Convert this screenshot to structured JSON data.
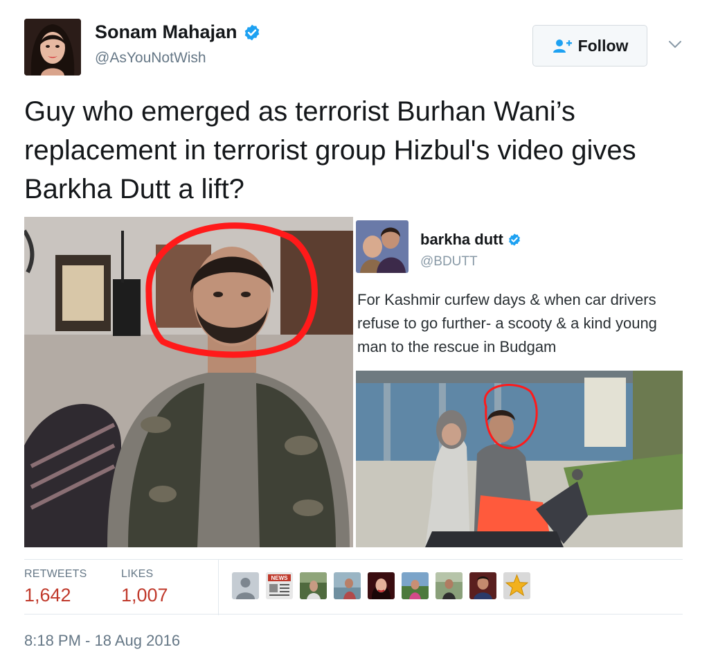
{
  "author": {
    "name": "Sonam Mahajan",
    "handle": "@AsYouNotWish",
    "verified": true
  },
  "follow_button": {
    "label": "Follow"
  },
  "tweet": {
    "text": "Guy who emerged as terrorist Burhan Wani’s replacement in terrorist group Hizbul's video gives Barkha Dutt a lift?"
  },
  "embedded_tweet": {
    "name": "barkha dutt",
    "handle": "@BDUTT",
    "text": "For Kashmir curfew days & when car drivers refuse to go further- a scooty & a kind young man to the rescue in Budgam"
  },
  "stats": {
    "retweets_label": "RETWEETS",
    "retweets_value": "1,642",
    "likes_label": "LIKES",
    "likes_value": "1,007"
  },
  "likers": [
    "default-avatar-icon",
    "news-avatar-icon",
    "photo-avatar",
    "photo-avatar",
    "photo-avatar",
    "photo-avatar",
    "photo-avatar",
    "photo-avatar",
    "star-badge-avatar-icon"
  ],
  "timestamp": "8:18 PM - 18 Aug 2016",
  "colors": {
    "verified_blue": "#1da1f2",
    "count_red": "#c0392b",
    "annotation_circle_red": "#ff1a1a",
    "secondary_text": "#657786"
  }
}
